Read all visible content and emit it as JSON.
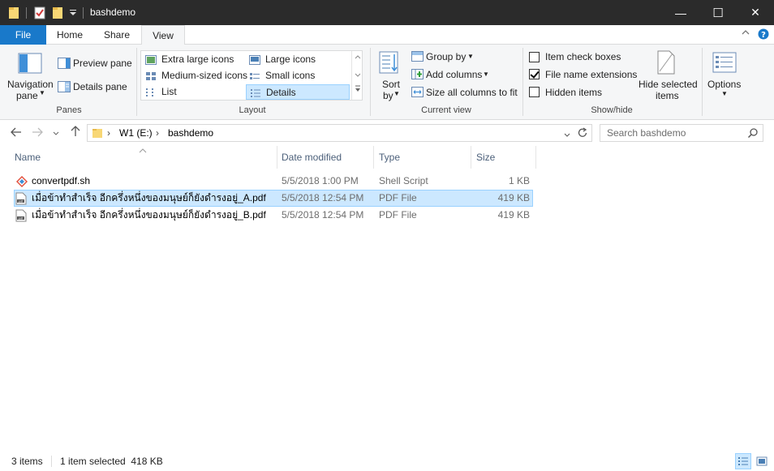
{
  "window": {
    "title": "bashdemo",
    "minimize": "—",
    "maximize": "☐",
    "close": "✕"
  },
  "tabs": [
    {
      "label": "File"
    },
    {
      "label": "Home"
    },
    {
      "label": "Share"
    },
    {
      "label": "View"
    }
  ],
  "ribbon": {
    "panes": {
      "nav_pane_line1": "Navigation",
      "nav_pane_line2": "pane",
      "preview_pane": "Preview pane",
      "details_pane": "Details pane",
      "label": "Panes"
    },
    "layout": {
      "label": "Layout",
      "items": [
        {
          "label": "Extra large icons"
        },
        {
          "label": "Large icons"
        },
        {
          "label": "Medium-sized icons"
        },
        {
          "label": "Small icons"
        },
        {
          "label": "List"
        },
        {
          "label": "Details"
        }
      ],
      "selected": "Details"
    },
    "current_view": {
      "label": "Current view",
      "sort_line1": "Sort",
      "sort_line2": "by",
      "group_by": "Group by",
      "add_columns": "Add columns",
      "size_all": "Size all columns to fit"
    },
    "show_hide": {
      "label": "Show/hide",
      "item_check_boxes": "Item check boxes",
      "item_check_boxes_checked": false,
      "file_name_extensions": "File name extensions",
      "file_name_extensions_checked": true,
      "hidden_items": "Hidden items",
      "hidden_items_checked": false,
      "hide_selected_line1": "Hide selected",
      "hide_selected_line2": "items"
    },
    "options": "Options"
  },
  "address": {
    "crumbs": [
      "W1 (E:)",
      "bashdemo"
    ],
    "search_placeholder": "Search bashdemo"
  },
  "columns": [
    {
      "label": "Name"
    },
    {
      "label": "Date modified"
    },
    {
      "label": "Type"
    },
    {
      "label": "Size"
    }
  ],
  "files": [
    {
      "name": "convertpdf.sh",
      "date": "5/5/2018 1:00 PM",
      "type": "Shell Script",
      "size": "1 KB",
      "selected": false,
      "icon": "shell-script-icon"
    },
    {
      "name": "เมื่อข้าทำสำเร็จ อีกครึ่งหนึ่งของมนุษย์ก็ยังดำรงอยู่_A.pdf",
      "date": "5/5/2018 12:54 PM",
      "type": "PDF File",
      "size": "419 KB",
      "selected": true,
      "icon": "pdf-file-icon"
    },
    {
      "name": "เมื่อข้าทำสำเร็จ อีกครึ่งหนึ่งของมนุษย์ก็ยังดำรงอยู่_B.pdf",
      "date": "5/5/2018 12:54 PM",
      "type": "PDF File",
      "size": "419 KB",
      "selected": false,
      "icon": "pdf-file-icon"
    }
  ],
  "status": {
    "count": "3 items",
    "selection": "1 item selected  418 KB"
  },
  "colors": {
    "accent": "#1979ca",
    "selection": "#cce8ff",
    "titlebar": "#2b2b2b"
  }
}
